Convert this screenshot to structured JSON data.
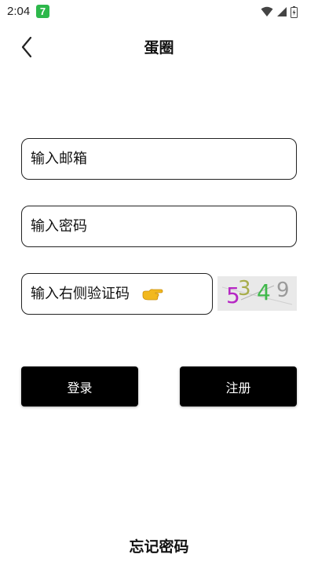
{
  "status_bar": {
    "time": "2:04",
    "app_badge": "7",
    "icons": [
      "wifi-icon",
      "cell-signal-icon",
      "battery-icon"
    ],
    "badge_color": "#2db84b"
  },
  "header": {
    "title": "蛋圈",
    "back_icon": "chevron-left-icon"
  },
  "form": {
    "email_placeholder": "输入邮箱",
    "password_placeholder": "输入密码",
    "captcha_placeholder": "输入右侧验证码",
    "captcha_pointer_icon": "pointing-hand-icon",
    "captcha_digits": [
      {
        "char": "5",
        "color": "#b626c4"
      },
      {
        "char": "3",
        "color": "#a8ad4a"
      },
      {
        "char": "4",
        "color": "#3fb84a"
      },
      {
        "char": "9",
        "color": "#9a9a9a"
      }
    ]
  },
  "buttons": {
    "login_label": "登录",
    "register_label": "注册"
  },
  "footer": {
    "forgot_password": "忘记密码"
  },
  "colors": {
    "button_bg": "#000000",
    "button_text": "#ffffff",
    "border": "#222222"
  }
}
